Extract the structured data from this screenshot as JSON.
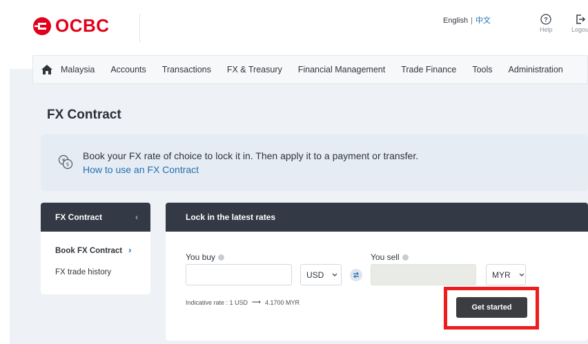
{
  "header": {
    "brand": "OCBC",
    "lang_en": "English",
    "lang_sep": "|",
    "lang_zh": "中文",
    "help_label": "Help",
    "logout_label": "Logou"
  },
  "nav": {
    "items": [
      "Malaysia",
      "Accounts",
      "Transactions",
      "FX & Treasury",
      "Financial Management",
      "Trade Finance",
      "Tools",
      "Administration"
    ]
  },
  "page": {
    "title": "FX Contract"
  },
  "banner": {
    "text": "Book your FX rate of choice to lock it in. Then apply it to a payment or transfer.",
    "link": "How to use an FX Contract"
  },
  "sidebar": {
    "title": "FX Contract",
    "collapse_glyph": "‹",
    "items": [
      {
        "label": "Book FX Contract",
        "active": true,
        "glyph": "›"
      },
      {
        "label": "FX trade history",
        "active": false
      }
    ]
  },
  "main": {
    "title": "Lock in the latest rates",
    "buy_label": "You buy",
    "buy_value": "",
    "buy_currency": "USD",
    "sell_label": "You sell",
    "sell_value": "",
    "sell_currency": "MYR",
    "rate_left": "Indicative rate : 1 USD",
    "rate_arrow": "⟶",
    "rate_right": "4.1700 MYR",
    "cta": "Get started"
  },
  "colors": {
    "brand_red": "#e1001a",
    "dark_header": "#343a45",
    "link_blue": "#1f6fb2",
    "highlight_red": "#ee1d1d"
  }
}
